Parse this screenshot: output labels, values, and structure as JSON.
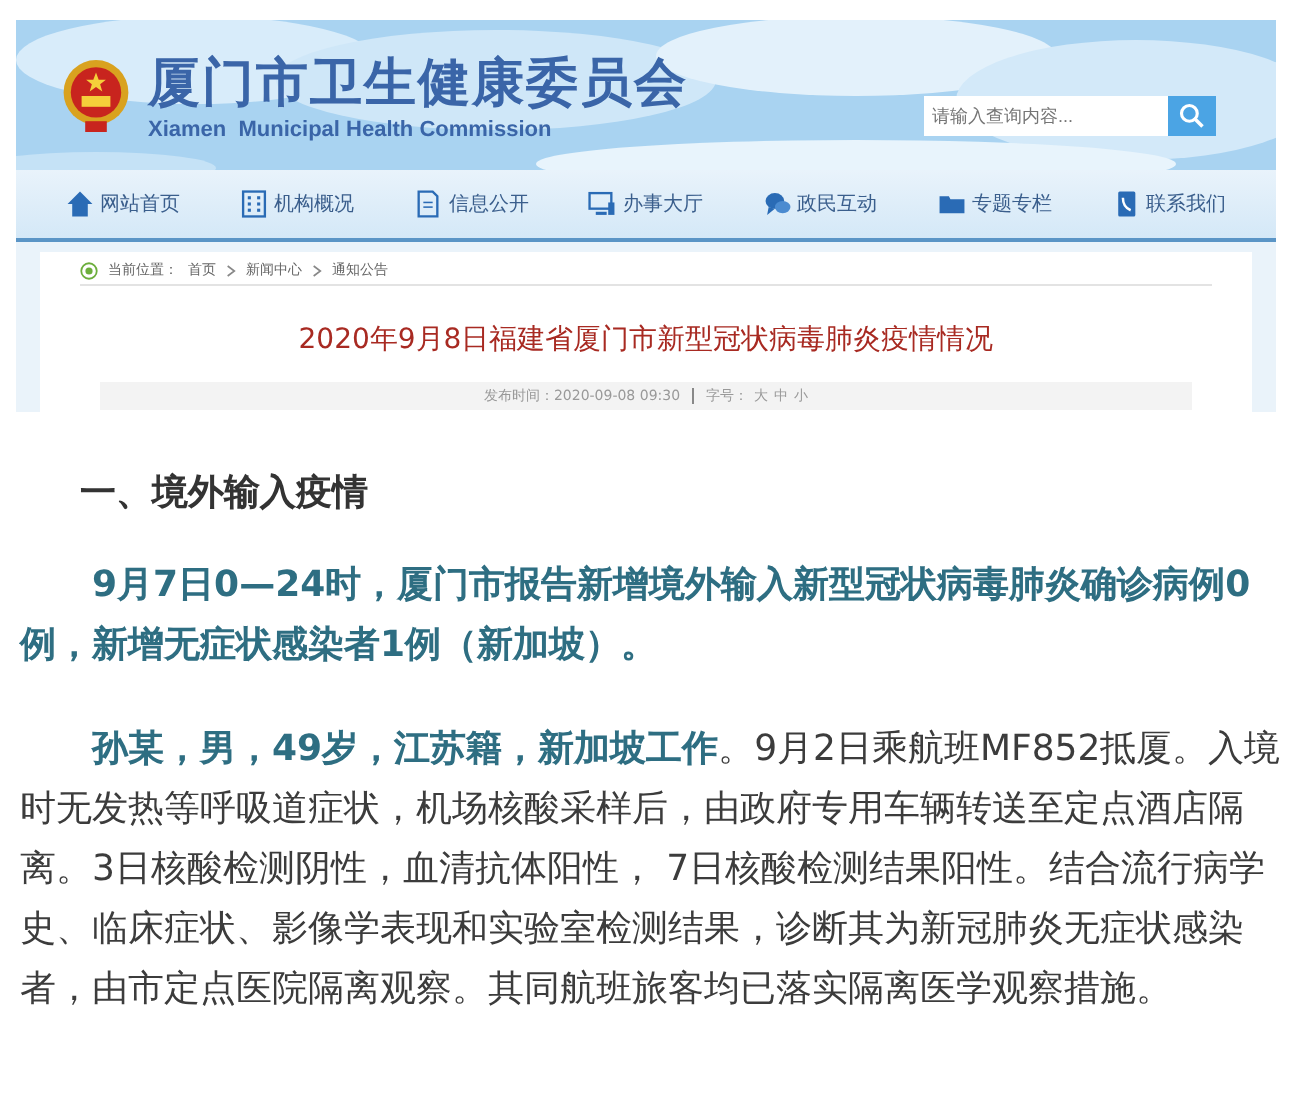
{
  "site": {
    "title": "厦门市卫生健康委员会",
    "subtitle": "Xiamen  Municipal Health Commission",
    "search": {
      "placeholder": "请输入查询内容..."
    }
  },
  "nav": [
    {
      "label": "网站首页",
      "kind": "home"
    },
    {
      "label": "机构概况",
      "kind": "building"
    },
    {
      "label": "信息公开",
      "kind": "document"
    },
    {
      "label": "办事大厅",
      "kind": "computer"
    },
    {
      "label": "政民互动",
      "kind": "chat"
    },
    {
      "label": "专题专栏",
      "kind": "folder"
    },
    {
      "label": "联系我们",
      "kind": "phone"
    }
  ],
  "breadcrumb": {
    "label": "当前位置：",
    "items": [
      "首页",
      "新闻中心",
      "通知公告"
    ]
  },
  "article_title": "2020年9月8日福建省厦门市新型冠状病毒肺炎疫情情况",
  "meta": {
    "date": "发布时间：2020-09-08 09:30",
    "font_size_label": "字号：",
    "sizes": [
      "大",
      "中",
      "小"
    ]
  },
  "body": [
    {
      "kind": "heading",
      "text": "一、境外输入疫情"
    },
    {
      "kind": "highlight",
      "text": "9月7日0—24时，厦门市报告新增境外输入新型冠状病毒肺炎确诊病例0例，新增无症状感染者1例（新加坡）。"
    },
    {
      "kind": "paragraph",
      "text": "**孙某，男，49岁，江苏籍，新加坡工作**。9月2日乘航班MF852抵厦。入境时无发热等呼吸道症状，机场核酸采样后，由政府专用车辆转送至定点酒店隔离。3日核酸检测阴性，血清抗体阳性， 7日核酸检测结果阳性。结合流行病学史、临床症状、影像学表现和实验室检测结果，诊断其为新冠肺炎无症状感染者，由市定点医院隔离观察。其同航班旅客均已落实隔离医学观察措施。"
    }
  ]
}
